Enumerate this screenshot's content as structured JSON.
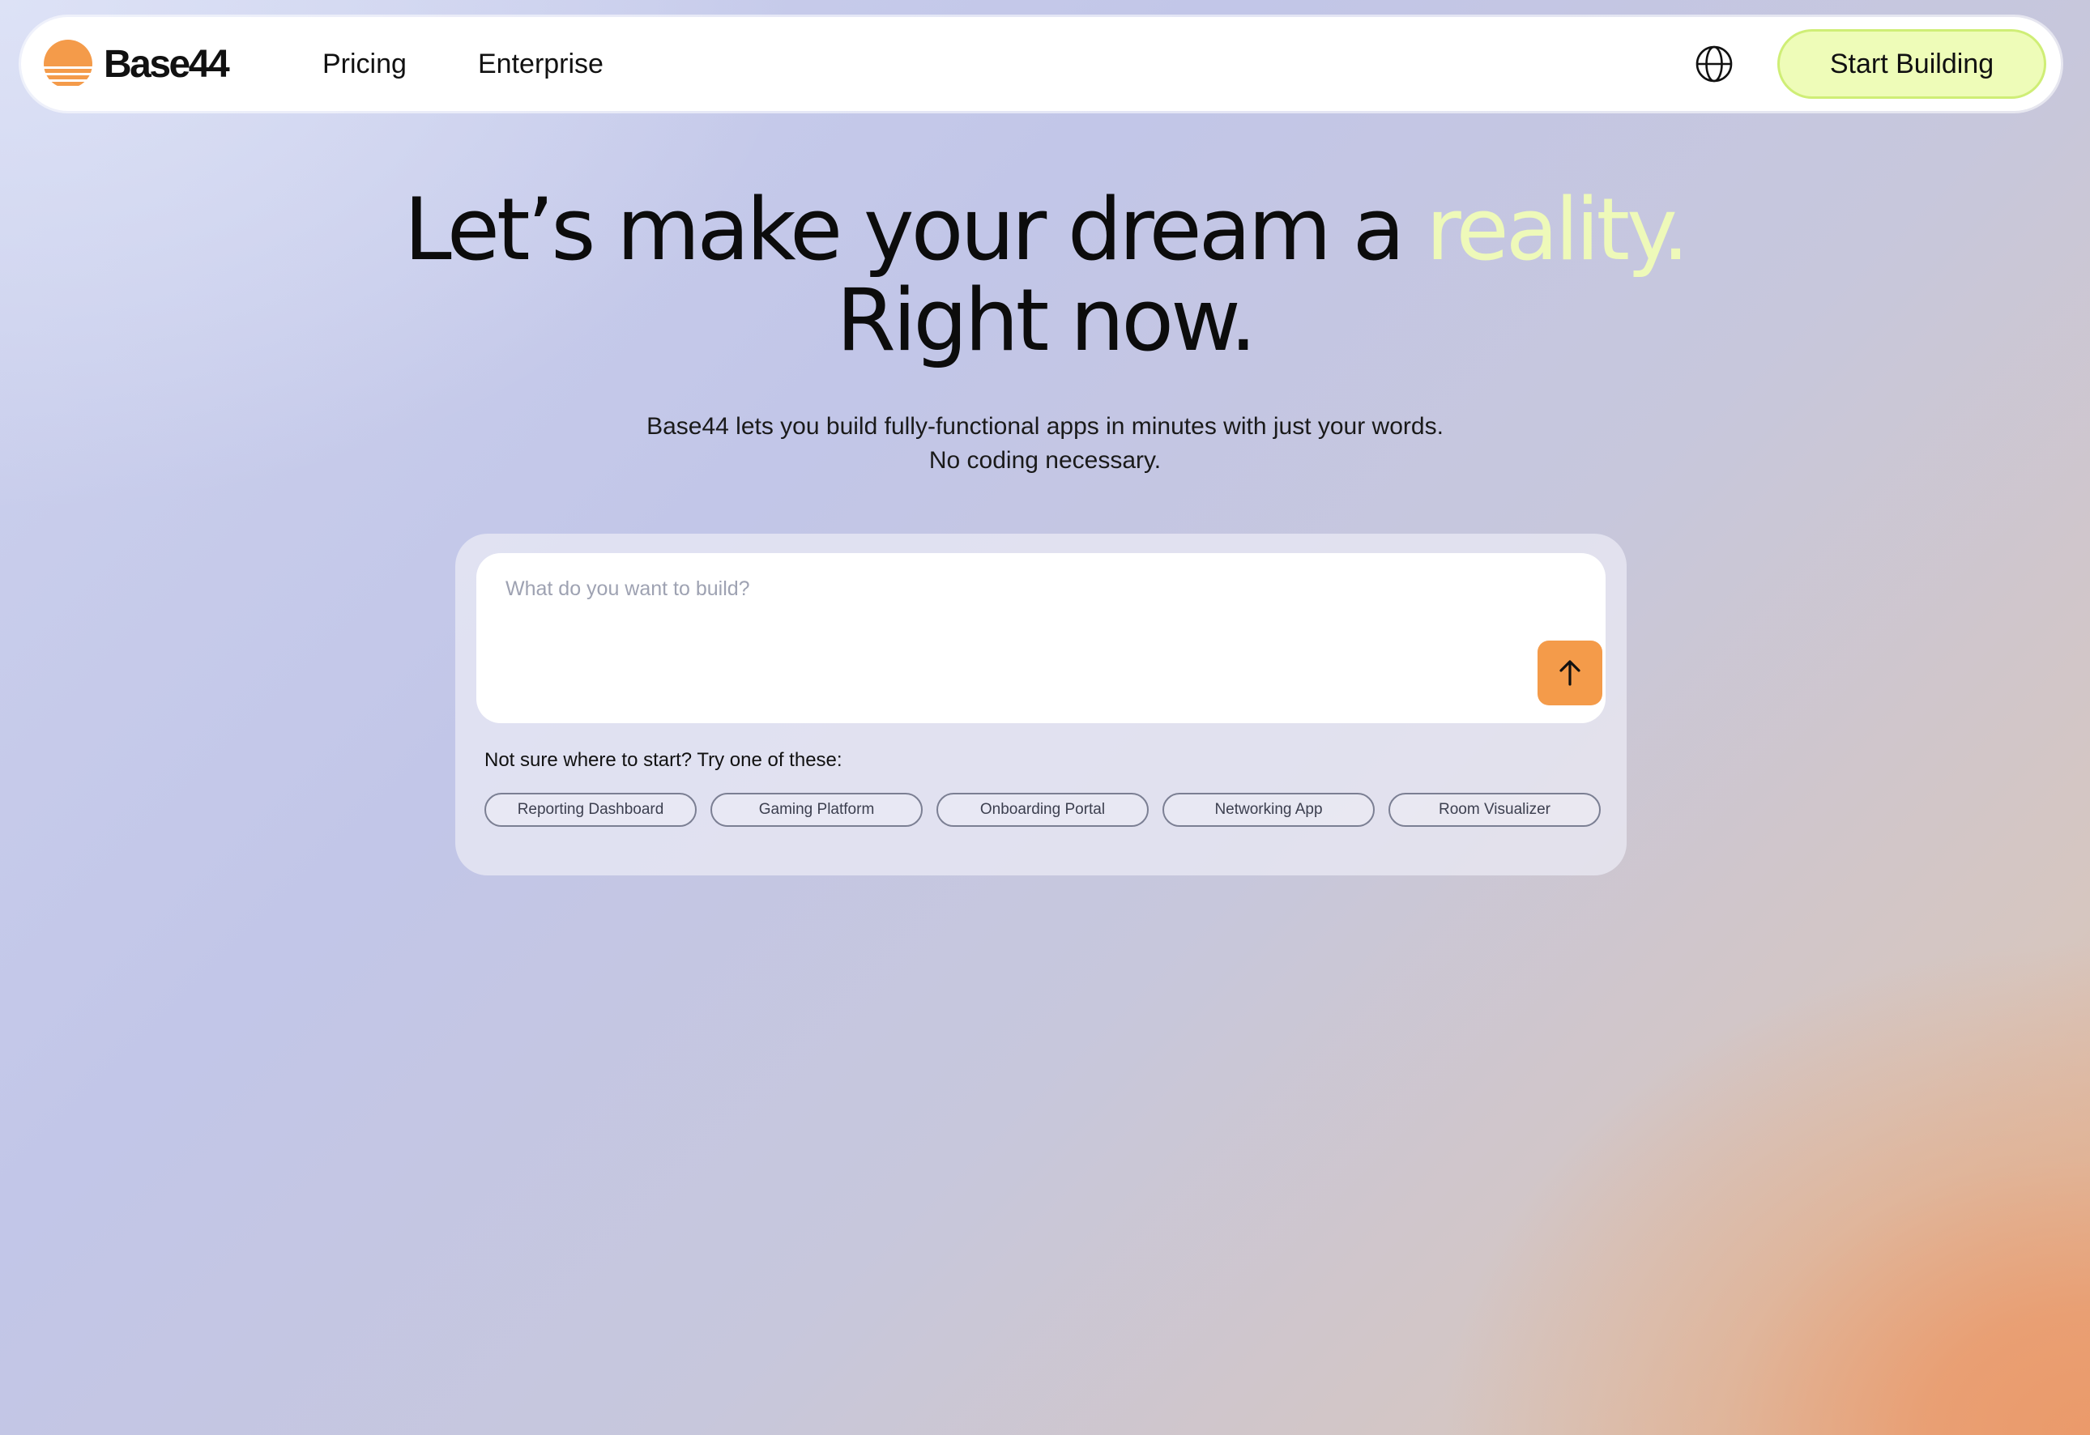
{
  "brand": {
    "name": "Base44",
    "logo_icon": "sun-stripes-logo-icon",
    "logo_color": "#f49b4a"
  },
  "nav": {
    "links": [
      "Pricing",
      "Enterprise"
    ],
    "language_icon": "globe-icon",
    "cta_label": "Start Building"
  },
  "hero": {
    "title_line1_prefix": "Let’s make your dream a",
    "title_line1_accent": "reality.",
    "title_line2": "Right now.",
    "subtitle_line1": "Base44 lets you build fully-functional apps in minutes with just your words.",
    "subtitle_line2": "No coding necessary.",
    "accent_color": "#eef9b9"
  },
  "prompt": {
    "placeholder": "What do you want to build?",
    "value": "",
    "submit_icon": "arrow-up-icon",
    "submit_color": "#f49b4a"
  },
  "suggestions": {
    "label": "Not sure where to start? Try one of these:",
    "items": [
      "Reporting Dashboard",
      "Gaming Platform",
      "Onboarding Portal",
      "Networking App",
      "Room Visualizer"
    ]
  }
}
